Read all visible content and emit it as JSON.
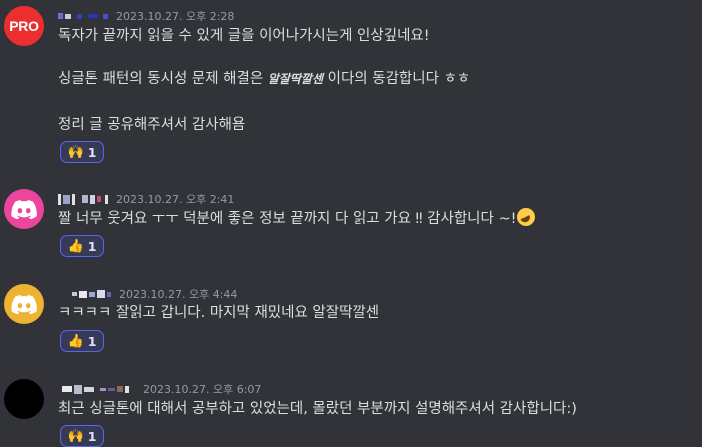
{
  "messages": [
    {
      "avatar_text": "PRO",
      "timestamp": "2023.10.27. 오후 2:28",
      "lines": [
        "독자가 끝까지 읽을 수 있게 글을 이어나가시는게 인상깊네요!",
        "싱글톤 패턴의 동시성 문제 해결은",
        "알잘딱깔센",
        "이다의 동감합니다 ㅎㅎ",
        "정리 글 공유해주셔서 감사해욤"
      ],
      "reaction": {
        "emoji": "🙌",
        "count": "1"
      }
    },
    {
      "avatar_icon": "discord-icon",
      "avatar_color": "#eb459e",
      "timestamp": "2023.10.27. 오후 2:41",
      "text": "짤 너무 웃겨요 ㅜㅜ 덕분에 좋은 정보 끝까지 다 읽고 가요 ‼ 감사합니다 ~!",
      "reaction": {
        "emoji": "👍",
        "count": "1"
      }
    },
    {
      "avatar_icon": "discord-icon",
      "avatar_color": "#f0b232",
      "timestamp": "2023.10.27. 오후 4:44",
      "text": "ㅋㅋㅋㅋ 잘읽고 갑니다. 마지막 재밌네요 알잘딱깔센",
      "reaction": {
        "emoji": "👍",
        "count": "1"
      }
    },
    {
      "timestamp": "2023.10.27. 오후 6:07",
      "text": "최근 싱글톤에 대해서 공부하고 있었는데, 몰랐던 부분까지 설명해주셔서 감사합니다:)",
      "reaction": {
        "emoji": "🙌",
        "count": "1"
      }
    }
  ]
}
